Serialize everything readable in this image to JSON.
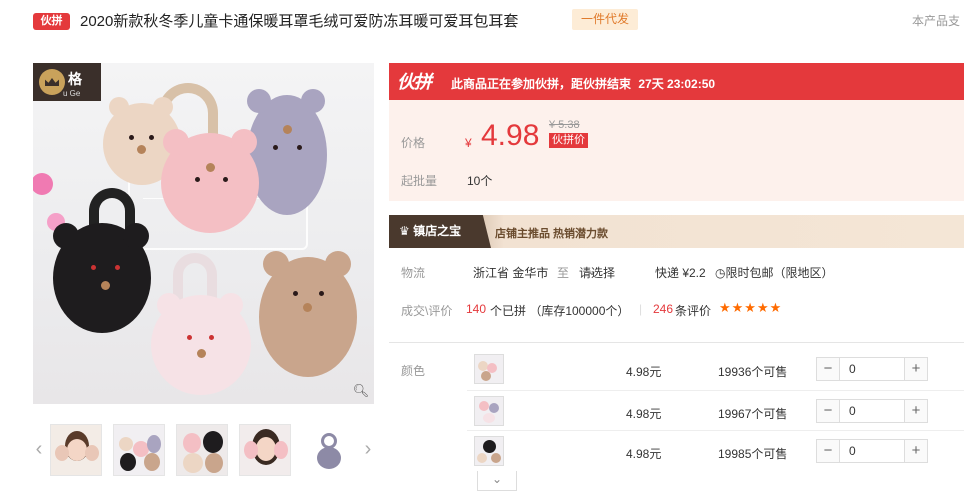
{
  "header": {
    "badge": "伙拼",
    "title": "2020新款秋冬季儿童卡通保暖耳罩毛绒可爱防冻耳暖可爱耳包耳套",
    "tag": "一件代发",
    "right_text": "本产品支"
  },
  "gallery": {
    "brand_name": "格",
    "brand_sub": "u Ge",
    "zoom_icon": "magnifier-icon",
    "prev_icon": "chevron-left-icon",
    "next_icon": "chevron-right-icon",
    "thumbnail_count": 5
  },
  "promo": {
    "logo": "伙拼",
    "text": "此商品正在参加伙拼，距伙拼结束",
    "countdown": "27天 23:02:50"
  },
  "price": {
    "label": "价格",
    "currency": "¥",
    "value": "4.98",
    "old_price": "¥ 5.38",
    "tag": "伙拼价",
    "moq_label": "起批量",
    "moq_value": "10个"
  },
  "shop": {
    "badge": "镇店之宝",
    "text": "店铺主推品  热销潜力款"
  },
  "logistics": {
    "label": "物流",
    "origin": "浙江省 金华市",
    "to": "至",
    "dest": "请选择",
    "express": "快递 ¥2.2",
    "free_ship": "限时包邮（限地区）"
  },
  "stats": {
    "label": "成交\\评价",
    "sold_num": "140",
    "sold_text": "个已拼 （库存100000个）",
    "sep": "|",
    "review_num": "246",
    "review_text": "条评价",
    "stars": "★★★★★"
  },
  "sku": {
    "label": "颜色",
    "rows": [
      {
        "price": "4.98元",
        "stock": "19936个可售",
        "qty": "0"
      },
      {
        "price": "4.98元",
        "stock": "19967个可售",
        "qty": "0"
      },
      {
        "price": "4.98元",
        "stock": "19985个可售",
        "qty": "0"
      }
    ],
    "minus": "−",
    "plus": "+",
    "more_icon": "chevron-down-icon"
  },
  "colors": {
    "accent": "#e4393c",
    "price_bg": "#fdf1ec",
    "star": "#ff6b00"
  }
}
